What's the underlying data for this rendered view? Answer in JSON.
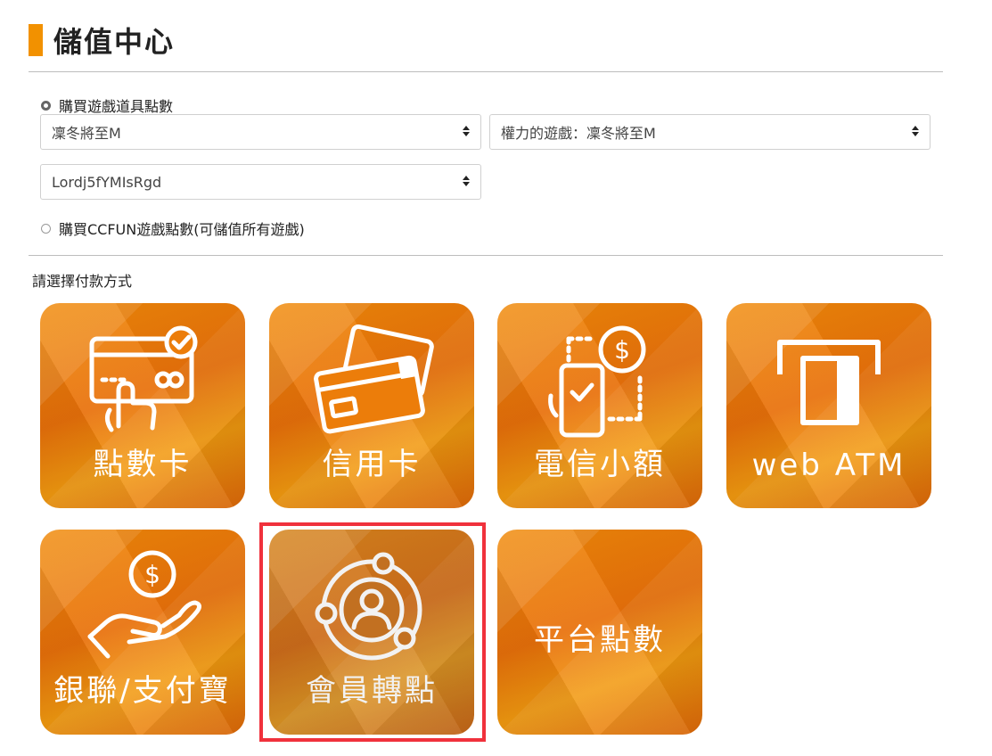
{
  "page": {
    "title": "儲值中心"
  },
  "purchase": {
    "option_game_points": "購買遊戲道具點數",
    "game_select_value": "凜冬將至M",
    "server_select_value": "權力的遊戲：凜冬將至M",
    "character_select_value": "Lordj5fYMIsRgd",
    "option_ccfun_points": "購買CCFUN遊戲點數(可儲值所有遊戲)"
  },
  "payment": {
    "label": "請選擇付款方式",
    "methods": [
      {
        "label": "點數卡",
        "icon": "point-card-icon"
      },
      {
        "label": "信用卡",
        "icon": "credit-card-icon"
      },
      {
        "label": "電信小額",
        "icon": "mobile-payment-icon"
      },
      {
        "label": "web ATM",
        "icon": "atm-icon"
      },
      {
        "label": "銀聯/支付寶",
        "icon": "hand-coin-icon"
      },
      {
        "label": "會員轉點",
        "icon": "member-transfer-icon"
      },
      {
        "label": "平台點數",
        "icon": ""
      }
    ],
    "selected": "會員轉點"
  },
  "colors": {
    "accent": "#f29100",
    "tile": "#ec7d0a",
    "selection": "#f0313c"
  }
}
